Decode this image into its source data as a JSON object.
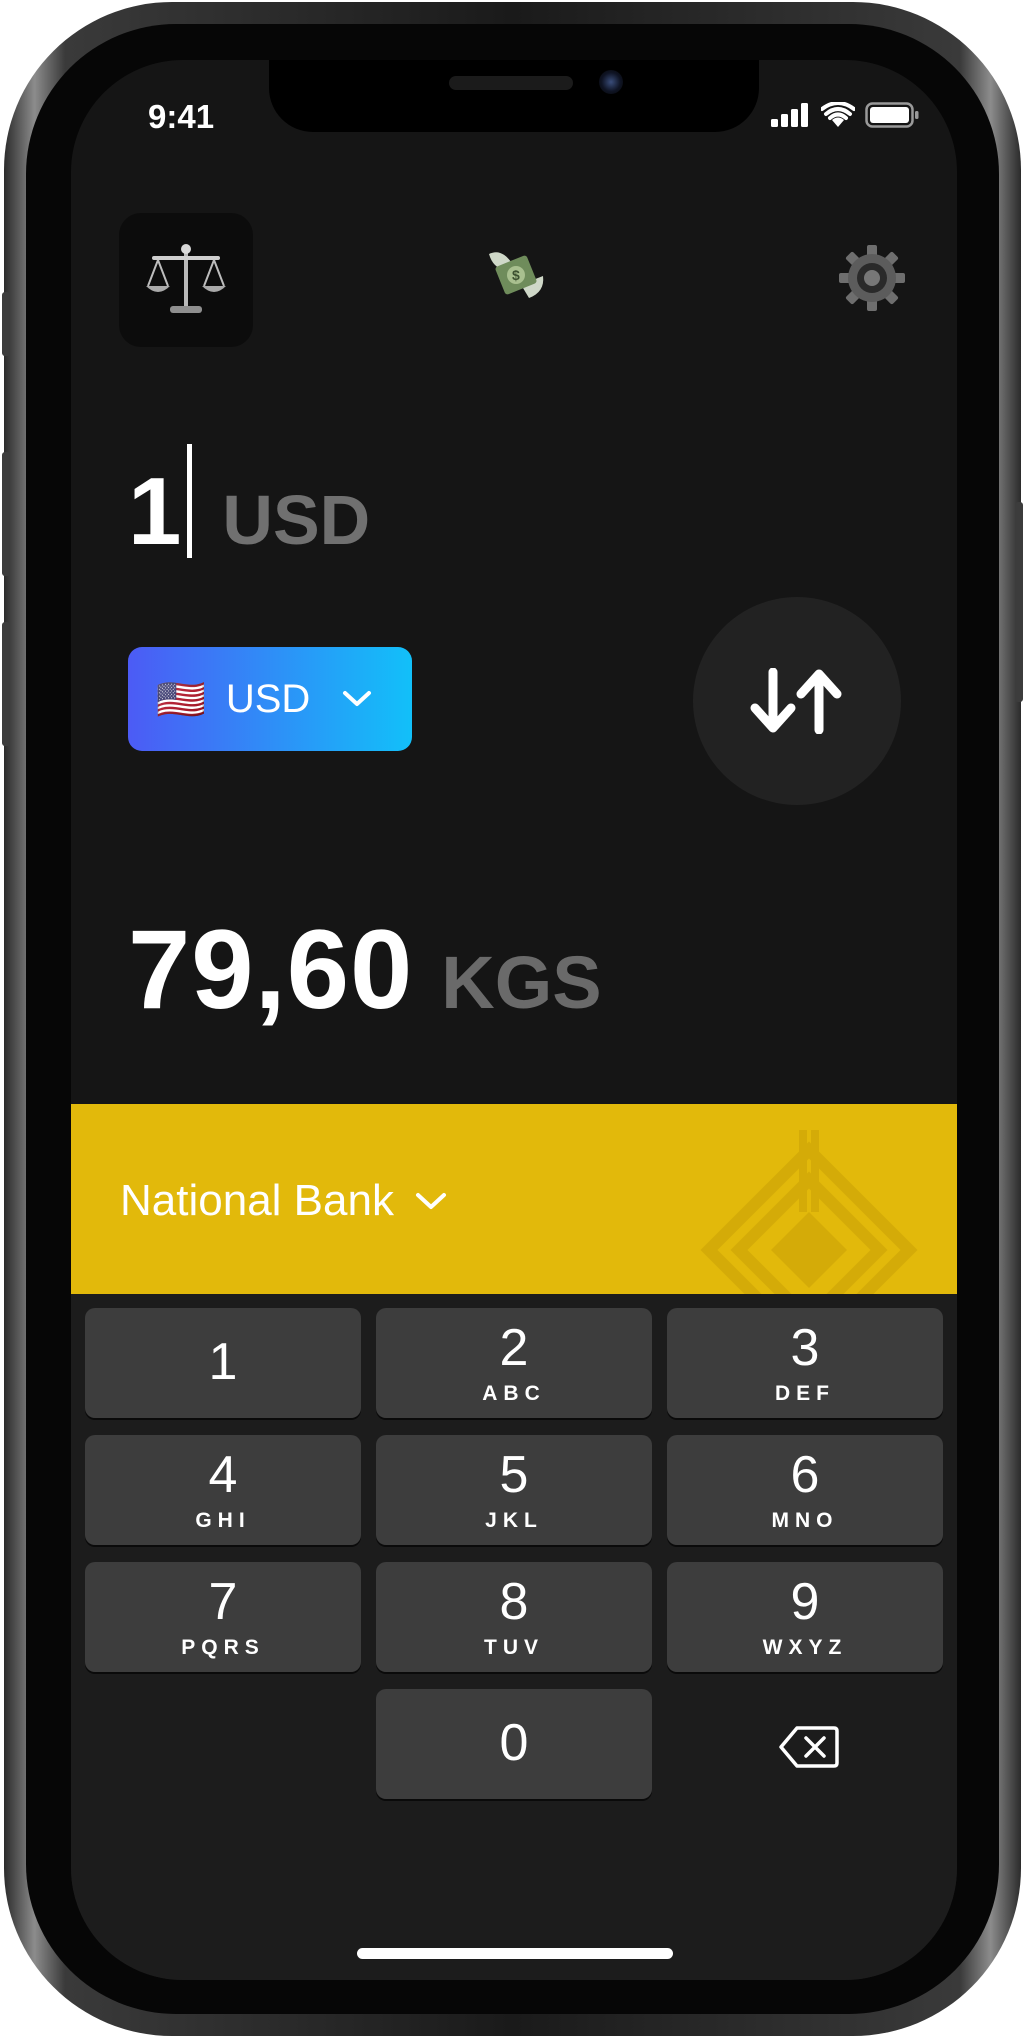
{
  "status_bar": {
    "time": "9:41"
  },
  "converter": {
    "input_amount": "1",
    "input_currency": "USD",
    "selector": {
      "flag": "🇺🇸",
      "code": "USD"
    },
    "result_amount": "79,60",
    "result_currency": "KGS"
  },
  "bank": {
    "label": "National Bank"
  },
  "keypad": {
    "keys": [
      {
        "digit": "1",
        "letters": ""
      },
      {
        "digit": "2",
        "letters": "ABC"
      },
      {
        "digit": "3",
        "letters": "DEF"
      },
      {
        "digit": "4",
        "letters": "GHI"
      },
      {
        "digit": "5",
        "letters": "JKL"
      },
      {
        "digit": "6",
        "letters": "MNO"
      },
      {
        "digit": "7",
        "letters": "PQRS"
      },
      {
        "digit": "8",
        "letters": "TUV"
      },
      {
        "digit": "9",
        "letters": "WXYZ"
      },
      {
        "digit": "0",
        "letters": ""
      }
    ]
  },
  "icons": {
    "top_left": "scales-icon",
    "center": "flying-money-icon",
    "top_right": "gear-icon",
    "swap": "swap-arrows-icon",
    "backspace": "backspace-icon"
  },
  "colors": {
    "background": "#151515",
    "bank_bar": "#e2b90b",
    "currency_button_start": "#4c5bf5",
    "currency_button_end": "#12c0f9",
    "key": "#3d3d3d"
  }
}
